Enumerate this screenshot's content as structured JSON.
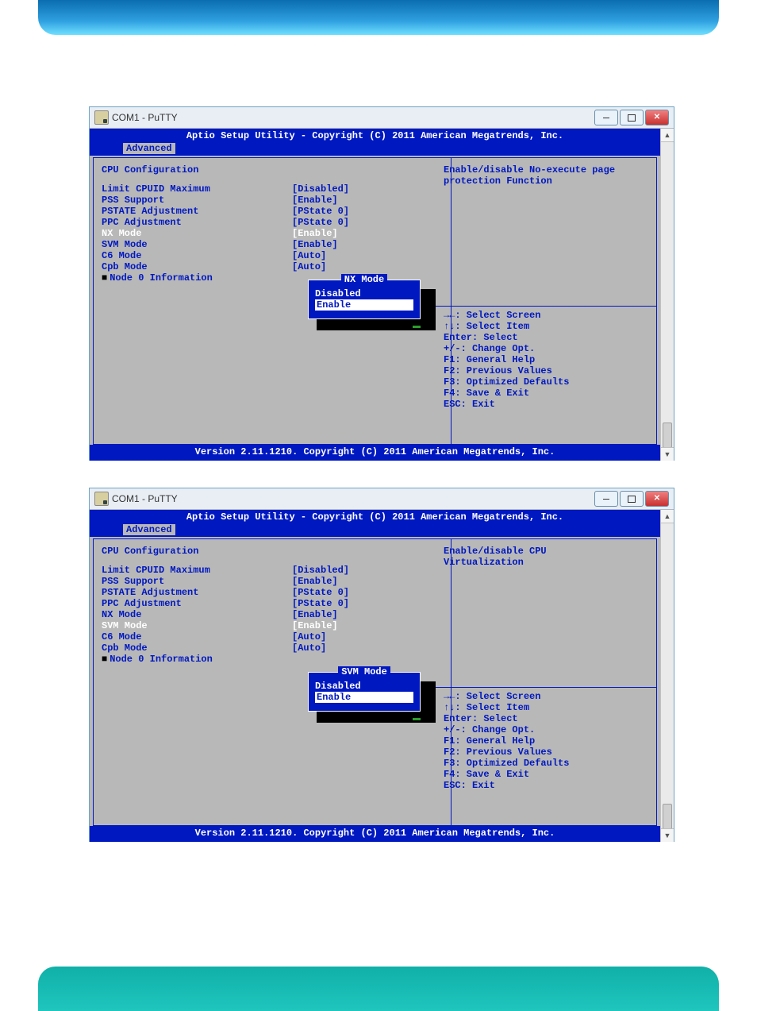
{
  "window": {
    "title": "COM1 - PuTTY"
  },
  "bios": {
    "header": "Aptio Setup Utility - Copyright (C) 2011 American Megatrends, Inc.",
    "tab": "Advanced",
    "footer": "Version 2.11.1210. Copyright (C) 2011 American Megatrends, Inc.",
    "section_title": "CPU Configuration",
    "help_nav": [
      "→←: Select Screen",
      "↑↓: Select Item",
      "Enter: Select",
      "+/-: Change Opt.",
      "F1: General Help",
      "F2: Previous Values",
      "F3: Optimized Defaults",
      "F4: Save & Exit",
      "ESC: Exit"
    ]
  },
  "screens": [
    {
      "help_text": [
        "Enable/disable No-execute page",
        "protection Function"
      ],
      "settings": [
        {
          "label": "Limit CPUID Maximum",
          "value": "[Disabled]",
          "hl": false
        },
        {
          "label": "PSS Support",
          "value": "[Enable]",
          "hl": false
        },
        {
          "label": "PSTATE Adjustment",
          "value": "[PState 0]",
          "hl": false
        },
        {
          "label": "PPC Adjustment",
          "value": "[PState 0]",
          "hl": false
        },
        {
          "label": "NX Mode",
          "value": "[Enable]",
          "hl": true
        },
        {
          "label": "SVM Mode",
          "value": "[Enable]",
          "hl": false
        },
        {
          "label": "C6 Mode",
          "value": "[Auto]",
          "hl": false
        },
        {
          "label": "Cpb Mode",
          "value": "[Auto]",
          "hl": false
        }
      ],
      "submenu": {
        "label": "Node 0 Information"
      },
      "popup": {
        "title": "NX Mode",
        "options": [
          "Disabled",
          "Enable"
        ],
        "selected": 1
      }
    },
    {
      "help_text": [
        "Enable/disable CPU",
        "Virtualization"
      ],
      "settings": [
        {
          "label": "Limit CPUID Maximum",
          "value": "[Disabled]",
          "hl": false
        },
        {
          "label": "PSS Support",
          "value": "[Enable]",
          "hl": false
        },
        {
          "label": "PSTATE Adjustment",
          "value": "[PState 0]",
          "hl": false
        },
        {
          "label": "PPC Adjustment",
          "value": "[PState 0]",
          "hl": false
        },
        {
          "label": "NX Mode",
          "value": "[Enable]",
          "hl": false
        },
        {
          "label": "SVM Mode",
          "value": "[Enable]",
          "hl": true
        },
        {
          "label": "C6 Mode",
          "value": "[Auto]",
          "hl": false
        },
        {
          "label": "Cpb Mode",
          "value": "[Auto]",
          "hl": false
        }
      ],
      "submenu": {
        "label": "Node 0 Information"
      },
      "popup": {
        "title": "SVM Mode",
        "options": [
          "Disabled",
          "Enable"
        ],
        "selected": 1
      }
    }
  ]
}
